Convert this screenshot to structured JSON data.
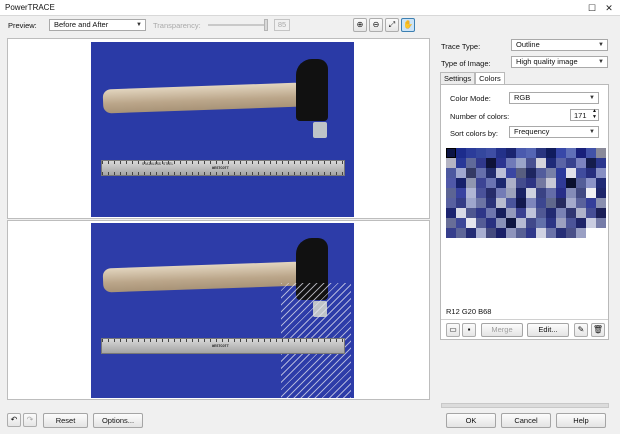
{
  "window": {
    "title": "PowerTRACE",
    "maximize_glyph": "☐",
    "close_glyph": "✕"
  },
  "toolbar": {
    "preview_label": "Preview:",
    "preview_value": "Before and After",
    "transparency_label": "Transparency:",
    "transparency_value": "85",
    "icons": [
      "zoom-in-icon",
      "zoom-out-icon",
      "fit-to-window-icon",
      "pan-hand-icon"
    ]
  },
  "trace": {
    "type_label": "Trace Type:",
    "type_value": "Outline",
    "image_type_label": "Type of Image:",
    "image_type_value": "High quality image"
  },
  "tabs": [
    {
      "label": "Settings"
    },
    {
      "label": "Colors"
    }
  ],
  "colors": {
    "mode_label": "Color Mode:",
    "mode_value": "RGB",
    "number_label": "Number of colors:",
    "number_value": "171",
    "sort_label": "Sort colors by:",
    "sort_value": "Frequency",
    "selected_rgb": "R12 G20 B68",
    "merge_label": "Merge",
    "edit_label": "Edit...",
    "palette": [
      "#0c1444",
      "#1c2c8c",
      "#2b3c9a",
      "#34479e",
      "#3e4ea4",
      "#23318a",
      "#1a2470",
      "#4a5aae",
      "#5566b4",
      "#2a3680",
      "#101c5c",
      "#3848a8",
      "#6070b8",
      "#18207a",
      "#4252a8",
      "#8a8a9a",
      "#b4b4c4",
      "#283898",
      "#606a9a",
      "#30388c",
      "#0e1238",
      "#2c3490",
      "#707ab8",
      "#9aa4c8",
      "#485090",
      "#d4d4dc",
      "#1e2a78",
      "#5a64a6",
      "#38428e",
      "#7c84c0",
      "#141c4c",
      "#2a368e",
      "#4c58a0",
      "#a0a8d0",
      "#343a64",
      "#6670ac",
      "#222c6c",
      "#bcc0d8",
      "#3a46a2",
      "#585e80",
      "#1e2660",
      "#525c9c",
      "#7880a8",
      "#2c3a9c",
      "#e2e2ea",
      "#404c9e",
      "#262e7e",
      "#8890c4",
      "#5058a8",
      "#16206a",
      "#9096b0",
      "#3c4494",
      "#6a74b2",
      "#1c286e",
      "#acb0c8",
      "#444c8e",
      "#2e3482",
      "#7478a0",
      "#c8c8d6",
      "#303a96",
      "#0a102e",
      "#545e98",
      "#8c94c8",
      "#202a74",
      "#5c6494",
      "#3842a0",
      "#b0b6d4",
      "#4a529a",
      "#262c6a",
      "#747cb6",
      "#9ca2bc",
      "#1a2264",
      "#cfd2e0",
      "#3a4284",
      "#646ca8",
      "#282e88",
      "#848cb8",
      "#424a82",
      "#f0f0f4",
      "#1e266a",
      "#5860a0",
      "#343c86",
      "#9ea6cc",
      "#6c74a4",
      "#2a3278",
      "#b8bcd0",
      "#4a549c",
      "#12184e",
      "#7e86bc",
      "#3c4690",
      "#60688c",
      "#262a5e",
      "#a4aacc",
      "#5a629c",
      "#343e9a",
      "#8a90b0",
      "#1c2470",
      "#d8dae6",
      "#4e5690",
      "#2e3688",
      "#6e76ae",
      "#161e5c",
      "#9499bc",
      "#3a4090",
      "#c0c4da",
      "#505894",
      "#222a72",
      "#7a82b4",
      "#303672",
      "#aeb2ca",
      "#464e96",
      "#1a1e56",
      "#686e98",
      "#3e4898",
      "#e6e6ee",
      "#545c96",
      "#283080",
      "#8890b8",
      "#0e1440",
      "#b6bad2",
      "#40488a",
      "#6270aa",
      "#2c3484",
      "#9ca0c0",
      "#4c5498",
      "#1e2468",
      "#cacde0",
      "#767ca8",
      "#363e8c",
      "#5e6698",
      "#242c74",
      "#a8aed0",
      "#444a7e",
      "#1a2068",
      "#8e94bc",
      "#586094",
      "#30388a",
      "#d0d2e2",
      "#6a72a8",
      "#262e76",
      "#4a5088",
      "#9aa0c4"
    ]
  },
  "footer": {
    "reset_label": "Reset",
    "options_label": "Options...",
    "ok_label": "OK",
    "cancel_label": "Cancel",
    "help_label": "Help"
  },
  "images": {
    "ruler_brand": "WESTCOTT",
    "ruler_maker": "STAINLESS STEEL"
  }
}
